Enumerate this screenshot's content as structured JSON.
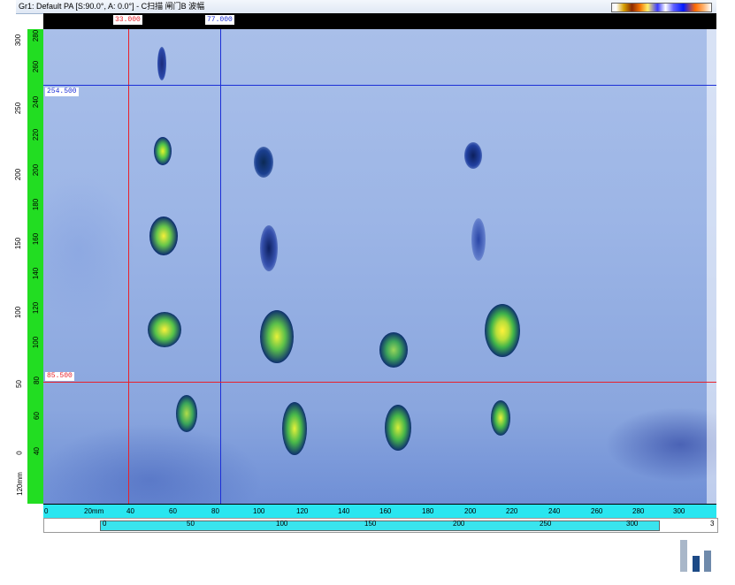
{
  "window": {
    "title": "Gr1: Default PA [S:90.0°, A: 0.0°] - C扫描 闸门B 波幅"
  },
  "cursors": {
    "vertical_red_label": "33.000",
    "vertical_blue_label": "77.000",
    "horizontal_blue_label": "254.500",
    "horizontal_red_label": "85.500"
  },
  "left_ruler": {
    "outer_labels": [
      "300",
      "250",
      "200",
      "150",
      "100",
      "50",
      "0",
      "120mm"
    ],
    "inner_labels": [
      "280",
      "260",
      "240",
      "220",
      "200",
      "180",
      "160",
      "140",
      "120",
      "100",
      "80",
      "60",
      "40"
    ]
  },
  "bottom_ruler": {
    "labels": [
      "0",
      "20mm",
      "40",
      "60",
      "80",
      "100",
      "120",
      "140",
      "160",
      "180",
      "200",
      "220",
      "240",
      "260",
      "280",
      "300"
    ]
  },
  "secondary_ruler": {
    "labels": [
      "0",
      "50",
      "100",
      "150",
      "200",
      "250",
      "300",
      "3"
    ]
  },
  "colors": {
    "red_cursor": "#e8202a",
    "blue_cursor": "#1c2fd6",
    "ruler_green": "#22dd22",
    "ruler_cyan": "#29e6f0",
    "scan_base": "#9cb5e6"
  },
  "icons": {
    "logo": "bar-chart-logo-icon"
  }
}
